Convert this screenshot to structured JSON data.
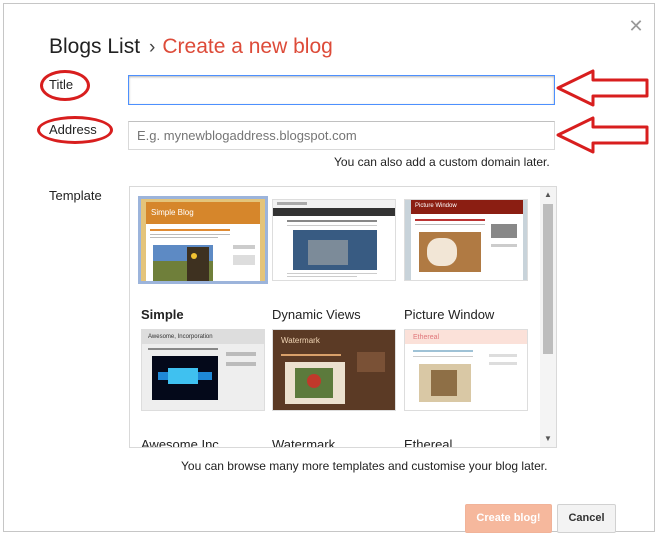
{
  "header": {
    "breadcrumb_root": "Blogs List",
    "separator": "›",
    "current": "Create a new blog",
    "close_glyph": "✕"
  },
  "form": {
    "title_label": "Title",
    "title_value": "",
    "address_label": "Address",
    "address_placeholder": "E.g. mynewblogaddress.blogspot.com",
    "domain_hint": "You can also add a custom domain later.",
    "template_label": "Template",
    "templates_hint": "You can browse many more templates and customise your blog later."
  },
  "templates": [
    {
      "name": "Simple",
      "selected": true,
      "thumb_title": "Simple Blog"
    },
    {
      "name": "Dynamic Views",
      "selected": false
    },
    {
      "name": "Picture Window",
      "selected": false,
      "thumb_title": "Picture Window"
    },
    {
      "name": "Awesome Inc.",
      "selected": false,
      "thumb_title": "Awesome, Incorporation"
    },
    {
      "name": "Watermark",
      "selected": false,
      "thumb_title": "Watermark"
    },
    {
      "name": "Ethereal",
      "selected": false,
      "thumb_title": "Ethereal"
    }
  ],
  "buttons": {
    "create": "Create blog!",
    "cancel": "Cancel"
  },
  "annotations": {
    "marker_color": "#d81e1e"
  },
  "colors": {
    "accent": "#dd4b39",
    "focus_border": "#4d90fe",
    "create_button": "#f6b89d"
  }
}
